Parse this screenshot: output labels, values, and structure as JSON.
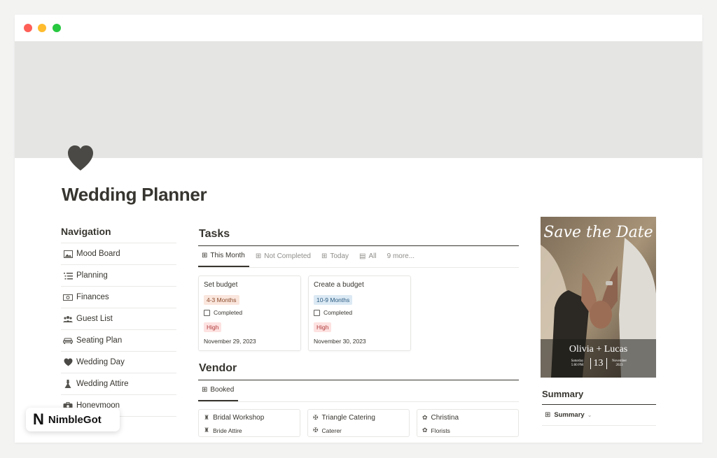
{
  "page": {
    "title": "Wedding Planner",
    "icon": "heart-icon"
  },
  "navigation": {
    "heading": "Navigation",
    "items": [
      {
        "label": "Mood Board",
        "icon": "image-icon"
      },
      {
        "label": "Planning",
        "icon": "list-icon"
      },
      {
        "label": "Finances",
        "icon": "money-icon"
      },
      {
        "label": "Guest List",
        "icon": "people-icon"
      },
      {
        "label": "Seating Plan",
        "icon": "sofa-icon"
      },
      {
        "label": "Wedding Day",
        "icon": "heart-icon"
      },
      {
        "label": "Wedding Attire",
        "icon": "dress-icon"
      },
      {
        "label": "Honeymoon",
        "icon": "luggage-icon"
      }
    ]
  },
  "tasks": {
    "title": "Tasks",
    "tabs": [
      "This Month",
      "Not Completed",
      "Today",
      "All",
      "9 more..."
    ],
    "cards": [
      {
        "title": "Set budget",
        "timeframe": "4-3 Months",
        "completed_label": "Completed",
        "priority": "High",
        "date": "November 29, 2023"
      },
      {
        "title": "Create a budget",
        "timeframe": "10-9 Months",
        "completed_label": "Completed",
        "priority": "High",
        "date": "November 30, 2023"
      }
    ]
  },
  "vendor": {
    "title": "Vendor",
    "tabs": [
      "Booked"
    ],
    "cards": [
      {
        "name": "Bridal Workshop",
        "type": "Bride Attire"
      },
      {
        "name": "Triangle Catering",
        "type": "Caterer"
      },
      {
        "name": "Christina",
        "type": "Florists"
      }
    ]
  },
  "save_the_date": {
    "title": "Save the Date",
    "names": "Olivia + Lucas",
    "day_of_week": "Saturday",
    "time": "5:00 PM",
    "day": "13",
    "month": "November",
    "year": "2023"
  },
  "summary": {
    "title": "Summary",
    "tab": "Summary"
  },
  "badge": {
    "logo": "N",
    "text": "NimbleGot"
  },
  "colors": {
    "cover": "#e5e5e3",
    "text": "#37352f",
    "tag_orange": "#fae6dd",
    "tag_blue": "#dbe9f4",
    "tag_red": "#fde2e1"
  }
}
